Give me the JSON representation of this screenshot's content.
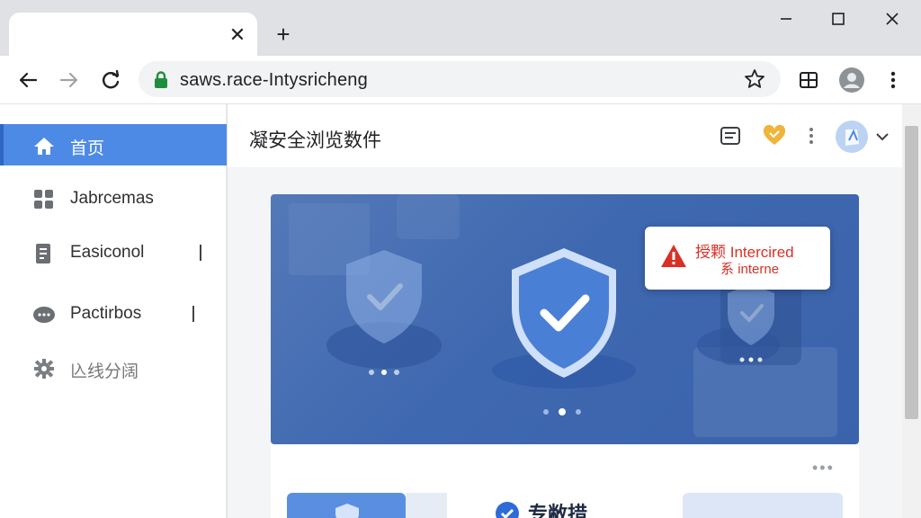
{
  "browser": {
    "tab_close": "✕",
    "new_tab": "+",
    "window": {
      "minimize": "—",
      "maximize": "☐",
      "close": "✕"
    },
    "url": "saws.race-Intysricheng"
  },
  "sidebar": {
    "items": [
      {
        "label": "首页",
        "icon": "home-icon",
        "active": true
      },
      {
        "label": "Jabrcemas",
        "icon": "grid-icon"
      },
      {
        "label": "Easiconol",
        "icon": "document-icon"
      },
      {
        "label": "Pactirbos",
        "icon": "chat-icon"
      },
      {
        "label": "兦线分阔",
        "icon": "gear-icon"
      }
    ]
  },
  "main": {
    "title": "凝安全浏览数件",
    "alert": {
      "line1_cjk": "授颗",
      "line1": "Intercired",
      "line2_cjk": "系",
      "line2": "interne"
    },
    "bottom_title": "专敝措",
    "more": "•••"
  },
  "colors": {
    "accent": "#4d8ae6",
    "hero": "#3e68b0",
    "shield": "#4a7fd6",
    "alert": "#d93025",
    "lock": "#1e8e3e",
    "badge": "#f0b43c"
  }
}
